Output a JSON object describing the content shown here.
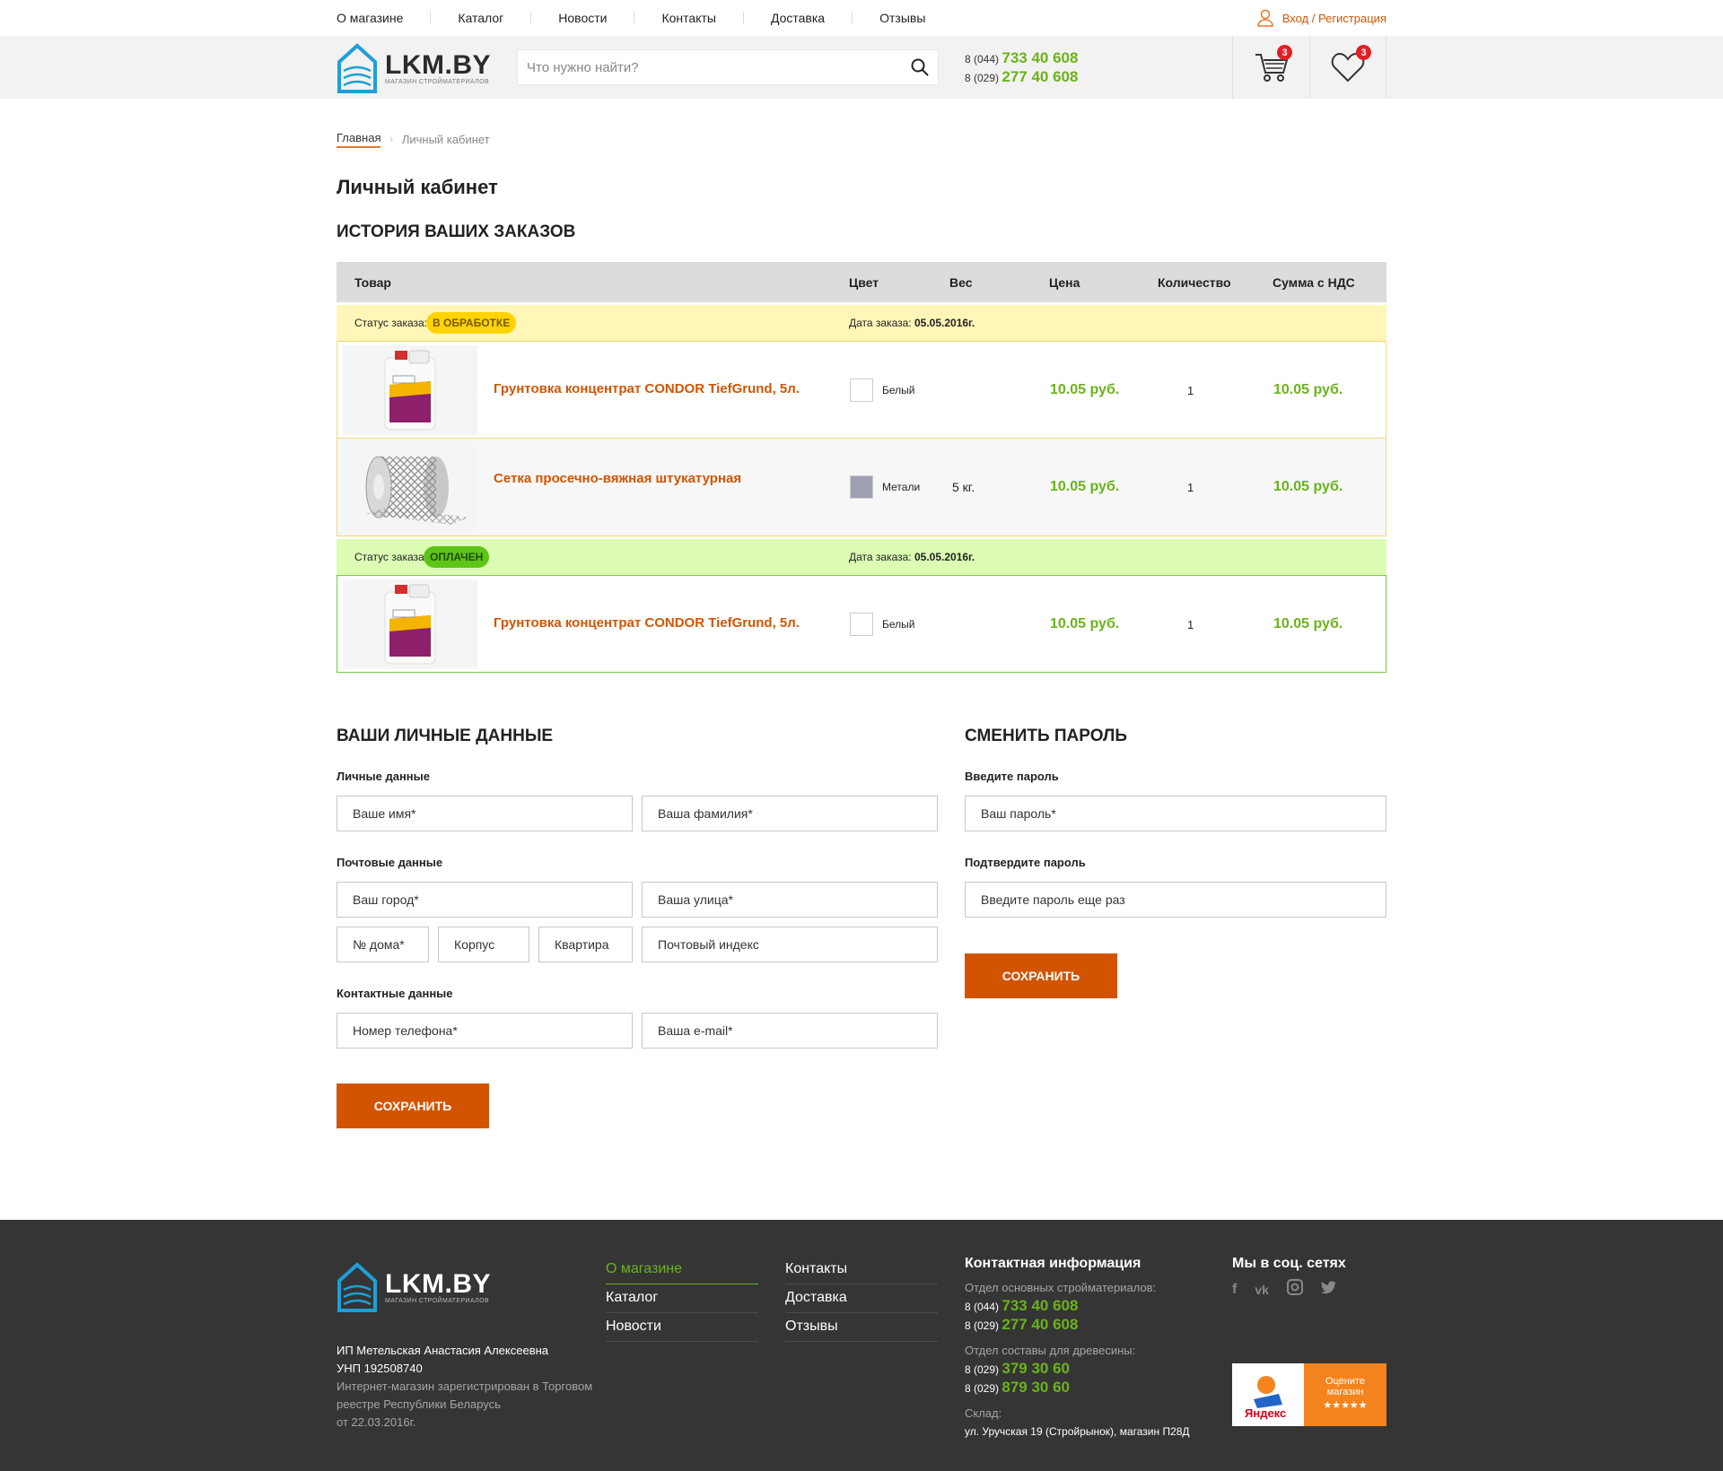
{
  "topnav": {
    "items": [
      "О магазине",
      "Каталог",
      "Новости",
      "Контакты",
      "Доставка",
      "Отзывы"
    ],
    "login": "Вход / Регистрация"
  },
  "header": {
    "logo_main": "LKM.BY",
    "logo_sub": "магазин стройматериалов",
    "search_placeholder": "Что нужно найти?",
    "phone1_prefix": "8 (044)",
    "phone1": "733 40 608",
    "phone2_prefix": "8 (029)",
    "phone2": "277 40 608",
    "cart_count": "3",
    "fav_count": "3"
  },
  "breadcrumb": {
    "home": "Главная",
    "current": "Личный кабинет"
  },
  "page_title": "Личный кабинет",
  "orders": {
    "title": "История ваших заказов",
    "columns": [
      "Товар",
      "Цвет",
      "Вес",
      "Цена",
      "Количество",
      "Сумма с НДС"
    ],
    "status_label": "Статус заказа:",
    "date_label": "Дата заказа:",
    "groups": [
      {
        "status": "В обработке",
        "date": "05.05.2016г.",
        "items": [
          {
            "name": "Грунтовка концентрат CONDOR TiefGrund, 5л.",
            "color": "Белый",
            "weight": "",
            "price": "10.05 руб.",
            "qty": "1",
            "sum": "10.05 руб."
          },
          {
            "name": "Сетка просечно-вяжная штукатурная",
            "color": "Метали",
            "weight": "5 кг.",
            "price": "10.05 руб.",
            "qty": "1",
            "sum": "10.05 руб."
          }
        ]
      },
      {
        "status": "Оплачен",
        "date": "05.05.2016г.",
        "items": [
          {
            "name": "Грунтовка концентрат CONDOR TiefGrund, 5л.",
            "color": "Белый",
            "weight": "",
            "price": "10.05 руб.",
            "qty": "1",
            "sum": "10.05 руб."
          }
        ]
      }
    ],
    "colors": {
      "processing_bg": "#fff6b8",
      "processing_pill": "#ffd400",
      "paid_bg": "#dcfcb4",
      "paid_pill": "#5ec416",
      "metal_swatch": "#a0a0b4"
    }
  },
  "personal": {
    "title": "Ваши личные данные",
    "personal_label": "Личные данные",
    "first_name": "Ваше имя*",
    "last_name": "Ваша фамилия*",
    "postal_label": "Почтовые данные",
    "city": "Ваш город*",
    "street": "Ваша улица*",
    "house": "№ дома*",
    "building": "Корпус",
    "apartment": "Квартира",
    "zip": "Почтовый индекс",
    "contact_label": "Контактные данные",
    "phone": "Номер телефона*",
    "email": "Ваша e-mail*",
    "save": "Сохранить"
  },
  "password": {
    "title": "Сменить пароль",
    "enter_label": "Введите пароль",
    "enter_placeholder": "Ваш пароль*",
    "confirm_label": "Подтвердите пароль",
    "confirm_placeholder": "Введите пароль еще раз",
    "save": "Сохранить"
  },
  "footer": {
    "legal1": "ИП Метельская Анастасия Алексеевна",
    "legal2": "УНП 192508740",
    "legal3": "Интернет-магазин зарегистрирован в Торговом реестре Республики Беларусь",
    "legal4": "от 22.03.2016г.",
    "col1": [
      "О магазине",
      "Каталог",
      "Новости"
    ],
    "col2": [
      "Контакты",
      "Доставка",
      "Отзывы"
    ],
    "contact_title": "Контактная информация",
    "dept1": "Отдел основных стройматериалов:",
    "dept1_p1_prefix": "8 (044)",
    "dept1_p1": "733 40 608",
    "dept1_p2_prefix": "8 (029)",
    "dept1_p2": "277 40 608",
    "dept2": "Отдел составы для древесины:",
    "dept2_p1_prefix": "8 (029)",
    "dept2_p1": "379 30 60",
    "dept2_p2_prefix": "8 (029)",
    "dept2_p2": "879 30 60",
    "warehouse": "Склад:",
    "address": "ул. Уручская 19 (Стройрынок), магазин П28Д",
    "social_title": "Мы в соц. сетях",
    "yandex_brand": "Яндекс",
    "yandex_text1": "Оцените",
    "yandex_text2": "магазин",
    "yandex_stars": "★★★★★"
  }
}
